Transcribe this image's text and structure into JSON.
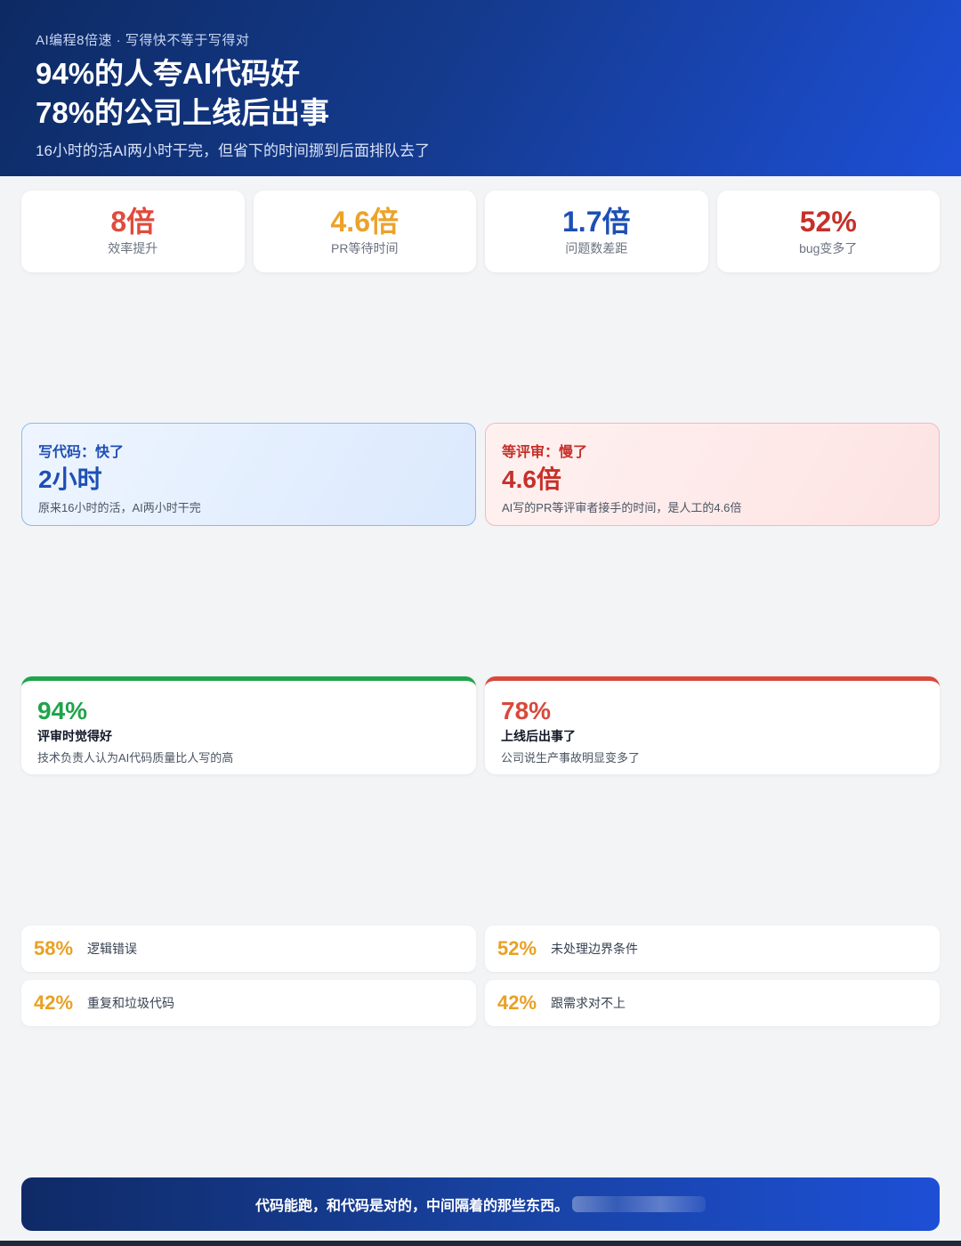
{
  "header": {
    "kicker": "AI编程8倍速 · 写得快不等于写得对",
    "title_line1": "94%的人夸AI代码好",
    "title_line2": "78%的公司上线后出事",
    "subtitle": "16小时的活AI两小时干完，但省下的时间挪到后面排队去了"
  },
  "stats": [
    {
      "value": "8倍",
      "label": "效率提升",
      "color": "#e04b3c"
    },
    {
      "value": "4.6倍",
      "label": "PR等待时间",
      "color": "#eca22a"
    },
    {
      "value": "1.7倍",
      "label": "问题数差距",
      "color": "#1d4fb4"
    },
    {
      "value": "52%",
      "label": "bug变多了",
      "color": "#c5312a"
    }
  ],
  "speed": {
    "fast": {
      "head": "写代码：快了",
      "big": "2小时",
      "desc": "原来16小时的活，AI两小时干完",
      "color": "#1d4fb4"
    },
    "slow": {
      "head": "等评审：慢了",
      "big": "4.6倍",
      "desc": "AI写的PR等评审者接手的时间，是人工的4.6倍",
      "color": "#c5312a"
    }
  },
  "opinion": {
    "good": {
      "big": "94%",
      "head": "评审时觉得好",
      "desc": "技术负责人认为AI代码质量比人写的高",
      "color": "#1fa44a"
    },
    "bad": {
      "big": "78%",
      "head": "上线后出事了",
      "desc": "公司说生产事故明显变多了",
      "color": "#d9483b"
    }
  },
  "issues": [
    {
      "pct": "58%",
      "text": "逻辑错误"
    },
    {
      "pct": "52%",
      "text": "未处理边界条件"
    },
    {
      "pct": "42%",
      "text": "重复和垃圾代码"
    },
    {
      "pct": "42%",
      "text": "跟需求对不上"
    }
  ],
  "footer": {
    "text": "代码能跑，和代码是对的，中间隔着的那些东西。"
  }
}
